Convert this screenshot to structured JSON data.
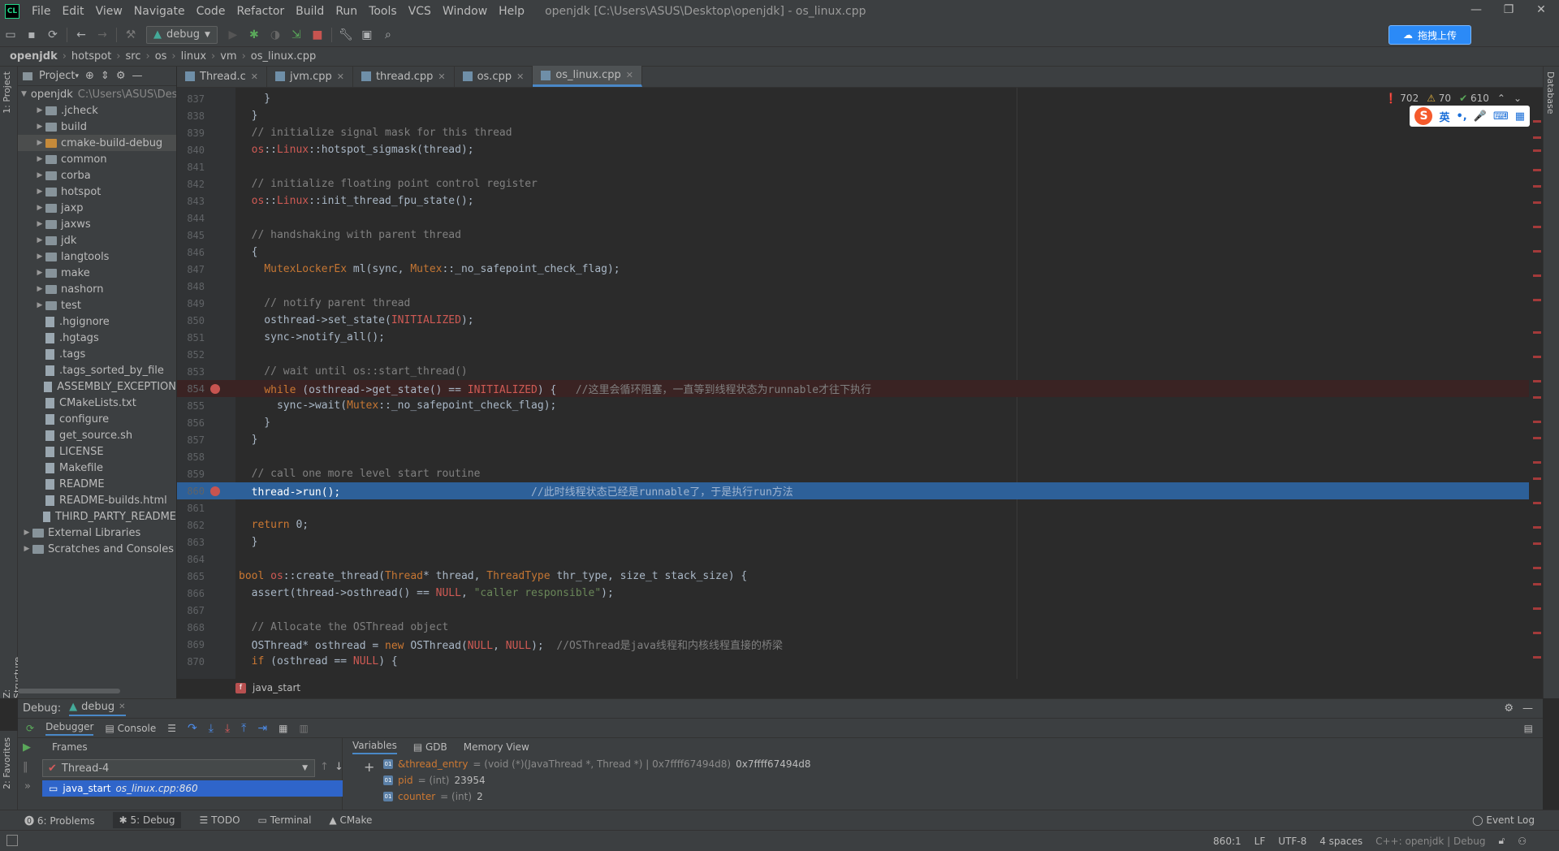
{
  "app": {
    "logo": "CL",
    "menus": [
      "File",
      "Edit",
      "View",
      "Navigate",
      "Code",
      "Refactor",
      "Build",
      "Run",
      "Tools",
      "VCS",
      "Window",
      "Help"
    ],
    "window_title": "openjdk [C:\\Users\\ASUS\\Desktop\\openjdk] - os_linux.cpp",
    "window_controls": [
      "—",
      "❐",
      "✕"
    ]
  },
  "toolbar": {
    "run_config": "debug",
    "upload_label": "拖拽上传"
  },
  "breadcrumb": [
    "openjdk",
    "hotspot",
    "src",
    "os",
    "linux",
    "vm",
    "os_linux.cpp"
  ],
  "left_stripe": {
    "project": "1: Project",
    "structure": "Z: Structure",
    "favorites": "2: Favorites"
  },
  "right_stripe": {
    "database": "Database"
  },
  "project": {
    "header": "Project",
    "items": [
      {
        "label": "openjdk",
        "hint": "C:\\Users\\ASUS\\Desktop\\openjdk",
        "kind": "folder",
        "depth": 0,
        "expanded": true
      },
      {
        "label": ".jcheck",
        "kind": "folder",
        "depth": 1
      },
      {
        "label": "build",
        "kind": "folder",
        "depth": 1
      },
      {
        "label": "cmake-build-debug",
        "kind": "folder-orange",
        "depth": 1,
        "selected": true
      },
      {
        "label": "common",
        "kind": "folder",
        "depth": 1
      },
      {
        "label": "corba",
        "kind": "folder",
        "depth": 1
      },
      {
        "label": "hotspot",
        "kind": "folder",
        "depth": 1
      },
      {
        "label": "jaxp",
        "kind": "folder",
        "depth": 1
      },
      {
        "label": "jaxws",
        "kind": "folder",
        "depth": 1
      },
      {
        "label": "jdk",
        "kind": "folder",
        "depth": 1
      },
      {
        "label": "langtools",
        "kind": "folder",
        "depth": 1
      },
      {
        "label": "make",
        "kind": "folder",
        "depth": 1
      },
      {
        "label": "nashorn",
        "kind": "folder",
        "depth": 1
      },
      {
        "label": "test",
        "kind": "folder",
        "depth": 1
      },
      {
        "label": ".hgignore",
        "kind": "file",
        "depth": 1
      },
      {
        "label": ".hgtags",
        "kind": "file",
        "depth": 1
      },
      {
        "label": ".tags",
        "kind": "file",
        "depth": 1
      },
      {
        "label": ".tags_sorted_by_file",
        "kind": "file",
        "depth": 1
      },
      {
        "label": "ASSEMBLY_EXCEPTION",
        "kind": "file",
        "depth": 1
      },
      {
        "label": "CMakeLists.txt",
        "kind": "file",
        "depth": 1
      },
      {
        "label": "configure",
        "kind": "file",
        "depth": 1
      },
      {
        "label": "get_source.sh",
        "kind": "file",
        "depth": 1
      },
      {
        "label": "LICENSE",
        "kind": "file",
        "depth": 1
      },
      {
        "label": "Makefile",
        "kind": "file",
        "depth": 1
      },
      {
        "label": "README",
        "kind": "file",
        "depth": 1
      },
      {
        "label": "README-builds.html",
        "kind": "file",
        "depth": 1
      },
      {
        "label": "THIRD_PARTY_README",
        "kind": "file",
        "depth": 1
      },
      {
        "label": "External Libraries",
        "kind": "folder",
        "depth": 0
      },
      {
        "label": "Scratches and Consoles",
        "kind": "folder",
        "depth": 0
      }
    ]
  },
  "editor_tabs": [
    {
      "label": "Thread.c",
      "active": false
    },
    {
      "label": "jvm.cpp",
      "active": false
    },
    {
      "label": "thread.cpp",
      "active": false
    },
    {
      "label": "os.cpp",
      "active": false
    },
    {
      "label": "os_linux.cpp",
      "active": true
    }
  ],
  "inspection": {
    "errors": "702",
    "warnings": "70",
    "ok": "610"
  },
  "ime": {
    "lang": "英",
    "punct": "•,",
    "mic": "🎤",
    "kbd": "⌨",
    "grid": "▦"
  },
  "code_lines": [
    {
      "n": "837",
      "text": "  }"
    },
    {
      "n": "838",
      "text": "}"
    },
    {
      "n": "839",
      "text": "// initialize signal mask for this thread",
      "cls": "c-comment"
    },
    {
      "n": "840",
      "text": "os::Linux::hotspot_sigmask(thread);"
    },
    {
      "n": "841",
      "text": ""
    },
    {
      "n": "842",
      "text": "// initialize floating point control register",
      "cls": "c-comment"
    },
    {
      "n": "843",
      "text": "os::Linux::init_thread_fpu_state();"
    },
    {
      "n": "844",
      "text": ""
    },
    {
      "n": "845",
      "text": "// handshaking with parent thread",
      "cls": "c-comment"
    },
    {
      "n": "846",
      "text": "{"
    },
    {
      "n": "847",
      "text": "  MutexLockerEx ml(sync, Mutex::_no_safepoint_check_flag);"
    },
    {
      "n": "848",
      "text": ""
    },
    {
      "n": "849",
      "text": "  // notify parent thread",
      "cls": "c-comment"
    },
    {
      "n": "850",
      "text": "  osthread->set_state(INITIALIZED);"
    },
    {
      "n": "851",
      "text": "  sync->notify_all();"
    },
    {
      "n": "852",
      "text": ""
    },
    {
      "n": "853",
      "text": "  // wait until os::start_thread()",
      "cls": "c-comment"
    },
    {
      "n": "854",
      "text": "  while (osthread->get_state() == INITIALIZED) {   //这里会循环阻塞，一直等到线程状态为runnable才往下执行",
      "bp": true
    },
    {
      "n": "855",
      "text": "    sync->wait(Mutex::_no_safepoint_check_flag);"
    },
    {
      "n": "856",
      "text": "  }"
    },
    {
      "n": "857",
      "text": "}"
    },
    {
      "n": "858",
      "text": ""
    },
    {
      "n": "859",
      "text": "// call one more level start routine",
      "cls": "c-comment"
    },
    {
      "n": "860",
      "text": "thread->run();                              //此时线程状态已经是runnable了，于是执行run方法",
      "exec": true,
      "bp": true
    },
    {
      "n": "861",
      "text": ""
    },
    {
      "n": "862",
      "text": "return 0;"
    },
    {
      "n": "863",
      "text": "}"
    },
    {
      "n": "864",
      "text": ""
    },
    {
      "n": "865",
      "text": "bool os::create_thread(Thread* thread, ThreadType thr_type, size_t stack_size) {",
      "indent": -1
    },
    {
      "n": "866",
      "text": "assert(thread->osthread() == NULL, \"caller responsible\");"
    },
    {
      "n": "867",
      "text": ""
    },
    {
      "n": "868",
      "text": "// Allocate the OSThread object",
      "cls": "c-comment"
    },
    {
      "n": "869",
      "text": "OSThread* osthread = new OSThread(NULL, NULL);  //OSThread是java线程和内核线程直接的桥梁"
    },
    {
      "n": "870",
      "text": "if (osthread == NULL) {"
    }
  ],
  "func_crumb": "java_start",
  "debug": {
    "title": "Debug:",
    "config_tab": "debug",
    "tabs": [
      "Debugger",
      "Console"
    ],
    "frames_label": "Frames",
    "thread": "Thread-4",
    "frame_fn": "java_start",
    "frame_loc": "os_linux.cpp:860",
    "var_tabs": [
      "Variables",
      "GDB",
      "Memory View"
    ],
    "variables": [
      {
        "name": "&thread_entry",
        "type": "= (void (*)(JavaThread *, Thread *) | 0x7ffff67494d8)",
        "value": "0x7ffff67494d8"
      },
      {
        "name": "pid",
        "type": "= (int)",
        "value": "23954"
      },
      {
        "name": "counter",
        "type": "= (int)",
        "value": "2"
      }
    ]
  },
  "tool_tabs": [
    "6: Problems",
    "5: Debug",
    "TODO",
    "Terminal",
    "CMake"
  ],
  "event_log": "Event Log",
  "status": {
    "position": "860:1",
    "line_sep": "LF",
    "encoding": "UTF-8",
    "indent": "4 spaces",
    "context": "C++: openjdk | Debug"
  },
  "colors": {
    "accent": "#4a88c7",
    "exec_line": "#2d6099",
    "breakpoint": "#c75450",
    "selected_frame": "#2f65ca"
  }
}
